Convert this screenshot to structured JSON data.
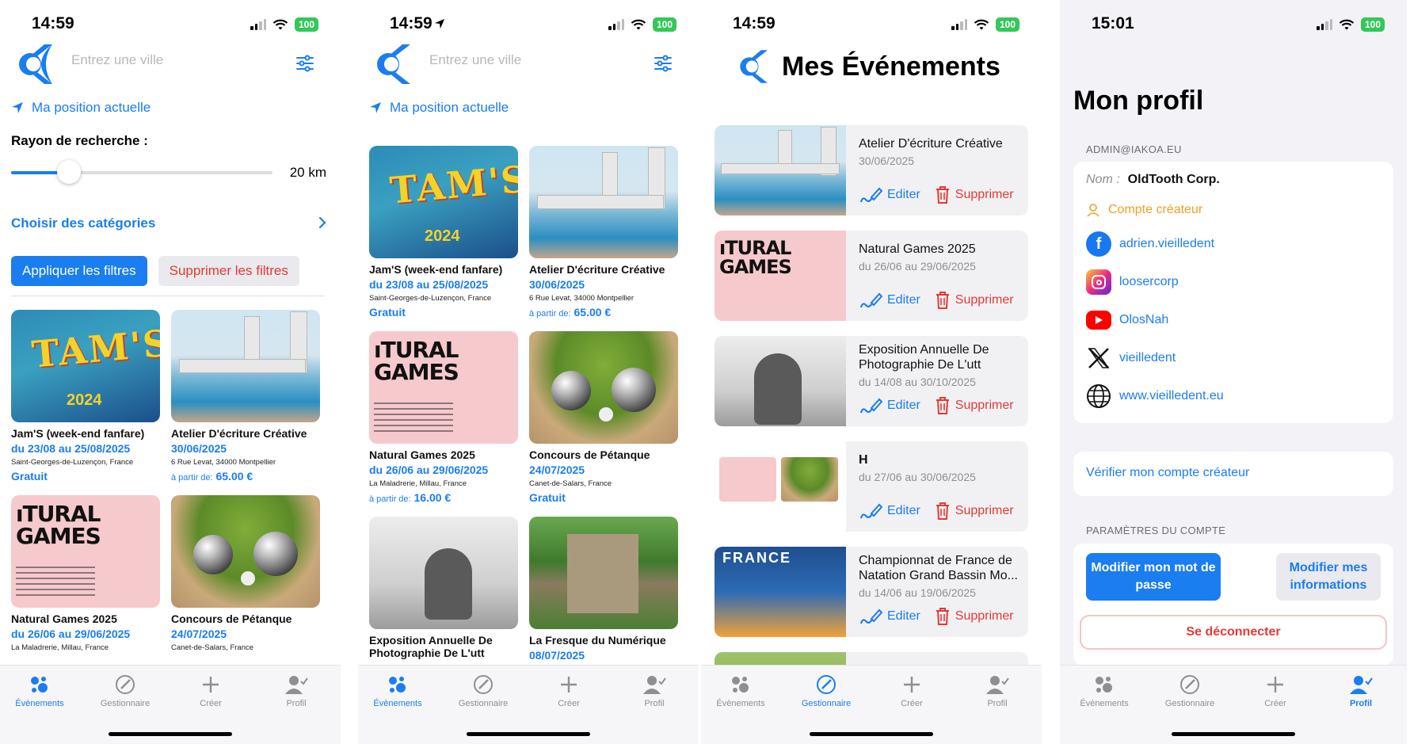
{
  "status": {
    "time1": "14:59",
    "time2": "14:59",
    "time3": "14:59",
    "time4": "15:01",
    "battery": "100"
  },
  "search": {
    "placeholder": "Entrez une ville",
    "current_position": "Ma position actuelle"
  },
  "filters": {
    "radius_label": "Rayon de recherche :",
    "radius_value": "20 km",
    "radius_fraction": 0.22,
    "categories_label": "Choisir des catégories",
    "apply_label": "Appliquer les filtres",
    "clear_label": "Supprimer les filtres"
  },
  "events": [
    {
      "title": "Jam'S (week-end fanfare)",
      "date": "du 23/08 au 25/08/2025",
      "address": "Saint-Georges-de-Luzençon, France",
      "price_label": "",
      "price": "Gratuit",
      "image": "jams"
    },
    {
      "title": "Atelier D'écriture Créative",
      "date": "30/06/2025",
      "address": "6 Rue Levat, 34000 Montpellier",
      "price_label": "à partir de:",
      "price": "65.00 €",
      "image": "pool"
    },
    {
      "title": "Natural Games 2025",
      "date": "du 26/06 au 29/06/2025",
      "address": "La Maladrerie, Millau, France",
      "price_label": "à partir de:",
      "price": "16.00 €",
      "image": "natural"
    },
    {
      "title": "Concours de Pétanque",
      "date": "24/07/2025",
      "address": "Canet-de-Salars, France",
      "price_label": "",
      "price": "Gratuit",
      "image": "petanque"
    },
    {
      "title": "Exposition Annuelle De Photographie De L'utt",
      "date": "",
      "address": "",
      "price_label": "",
      "price": "",
      "image": "statue"
    },
    {
      "title": "La Fresque du Numérique",
      "date": "08/07/2025",
      "address": "",
      "price_label": "",
      "price": "",
      "image": "fresque"
    }
  ],
  "my_events": {
    "title": "Mes Événements",
    "edit_label": "Editer",
    "delete_label": "Supprimer",
    "items": [
      {
        "title": "Atelier D'écriture Créative",
        "date": "30/06/2025",
        "image": "pool"
      },
      {
        "title": "Natural Games 2025",
        "date": "du 26/06 au 29/06/2025",
        "image": "natural"
      },
      {
        "title": "Exposition Annuelle De Photographie De L'utt",
        "date": "du 14/08 au 30/10/2025",
        "image": "statue"
      },
      {
        "title": "H",
        "date": "du 27/06 au 30/06/2025",
        "image": "h"
      },
      {
        "title": "Championnat de France de Natation Grand Bassin Mo...",
        "date": "du 14/06 au 19/06/2025",
        "image": "france"
      }
    ]
  },
  "profile": {
    "title": "Mon profil",
    "email_header": "ADMIN@IAKOA.EU",
    "name_label": "Nom :",
    "name_value": "OldTooth Corp.",
    "creator_label": "Compte créateur",
    "facebook": "adrien.vieilledent",
    "instagram": "loosercorp",
    "youtube": "OlosNah",
    "x": "vieilledent",
    "website": "www.vieilledent.eu",
    "verify_label": "Vérifier mon compte créateur",
    "settings_header": "PARAMÈTRES DU COMPTE",
    "change_password": "Modifier mon mot de passe",
    "edit_info": "Modifier mes informations",
    "logout": "Se déconnecter"
  },
  "tabs": [
    {
      "label": "Évènements",
      "icon": "events-icon"
    },
    {
      "label": "Gestionnaire",
      "icon": "manager-icon"
    },
    {
      "label": "Créer",
      "icon": "plus-icon"
    },
    {
      "label": "Profil",
      "icon": "profile-icon"
    }
  ],
  "colors": {
    "accent": "#1a7df0",
    "danger": "#e53935",
    "creator": "#f0a020"
  }
}
